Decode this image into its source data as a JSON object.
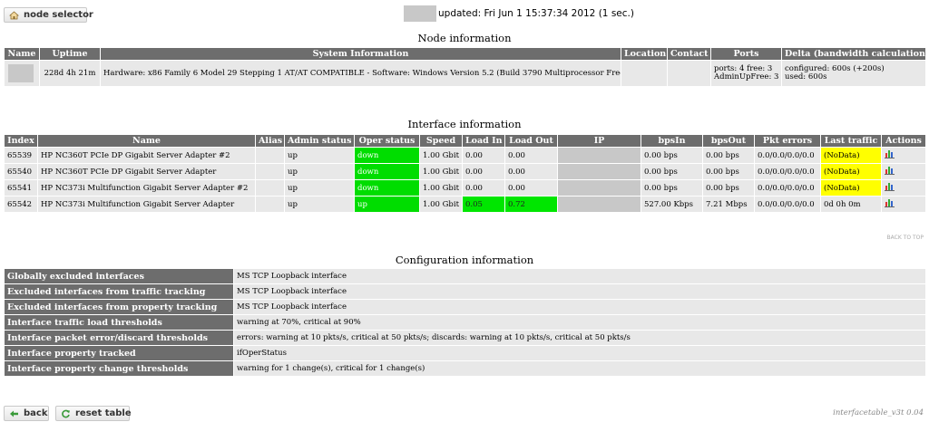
{
  "toolbar": {
    "node_selector_label": "node selector",
    "updated_text": "updated: Fri Jun 1 15:37:34 2012 (1 sec.)"
  },
  "node": {
    "title": "Node information",
    "headers": [
      "Name",
      "Uptime",
      "System Information",
      "Location",
      "Contact",
      "Ports",
      "Delta (bandwidth calculations)"
    ],
    "uptime": "228d 4h 21m",
    "system_info": "Hardware: x86 Family 6 Model 29 Stepping 1 AT/AT COMPATIBLE - Software: Windows Version 5.2 (Build 3790 Multiprocessor Free)",
    "location": "",
    "contact": "",
    "ports_line1": "ports: 4 free: 3",
    "ports_line2": "AdminUpFree: 3",
    "delta_line1": "configured: 600s (+200s)",
    "delta_line2": "used: 600s"
  },
  "interfaces": {
    "title": "Interface information",
    "headers": [
      "Index",
      "Name",
      "Alias",
      "Admin status",
      "Oper status",
      "Speed",
      "Load In",
      "Load Out",
      "IP",
      "bpsIn",
      "bpsOut",
      "Pkt errors",
      "Last traffic",
      "Actions"
    ],
    "rows": [
      {
        "index": "65539",
        "name": "HP NC360T PCIe DP Gigabit Server Adapter #2",
        "alias": "",
        "admin": "up",
        "oper": "down",
        "speed": "1.00 Gbit",
        "load_in": "0.00",
        "load_out": "0.00",
        "bps_in": "0.00 bps",
        "bps_out": "0.00 bps",
        "pkt_errors": "0.0/0.0/0.0/0.0",
        "last_traffic": "(NoData)"
      },
      {
        "index": "65540",
        "name": "HP NC360T PCIe DP Gigabit Server Adapter",
        "alias": "",
        "admin": "up",
        "oper": "down",
        "speed": "1.00 Gbit",
        "load_in": "0.00",
        "load_out": "0.00",
        "bps_in": "0.00 bps",
        "bps_out": "0.00 bps",
        "pkt_errors": "0.0/0.0/0.0/0.0",
        "last_traffic": "(NoData)"
      },
      {
        "index": "65541",
        "name": "HP NC373i Multifunction Gigabit Server Adapter #2",
        "alias": "",
        "admin": "up",
        "oper": "down",
        "speed": "1.00 Gbit",
        "load_in": "0.00",
        "load_out": "0.00",
        "bps_in": "0.00 bps",
        "bps_out": "0.00 bps",
        "pkt_errors": "0.0/0.0/0.0/0.0",
        "last_traffic": "(NoData)"
      },
      {
        "index": "65542",
        "name": "HP NC373i Multifunction Gigabit Server Adapter",
        "alias": "",
        "admin": "up",
        "oper": "up",
        "speed": "1.00 Gbit",
        "load_in": "0.05",
        "load_out": "0.72",
        "bps_in": "527.00 Kbps",
        "bps_out": "7.21 Mbps",
        "pkt_errors": "0.0/0.0/0.0/0.0",
        "last_traffic": "0d 0h 0m"
      }
    ],
    "back_to_top": "BACK TO TOP"
  },
  "config": {
    "title": "Configuration information",
    "rows": [
      {
        "label": "Globally excluded interfaces",
        "value": "MS TCP Loopback interface"
      },
      {
        "label": "Excluded interfaces from traffic tracking",
        "value": "MS TCP Loopback interface"
      },
      {
        "label": "Excluded interfaces from property tracking",
        "value": "MS TCP Loopback interface"
      },
      {
        "label": "Interface traffic load thresholds",
        "value": "warning at 70%, critical at 90%"
      },
      {
        "label": "Interface packet error/discard thresholds",
        "value": "errors: warning at 10 pkts/s, critical at 50 pkts/s; discards: warning at 10 pkts/s, critical at 50 pkts/s"
      },
      {
        "label": "Interface property tracked",
        "value": "ifOperStatus"
      },
      {
        "label": "Interface property change thresholds",
        "value": "warning for 1 change(s), critical for 1 change(s)"
      }
    ]
  },
  "footer": {
    "back_label": "back",
    "reset_label": "reset table",
    "version": "interfacetable_v3t 0.04"
  },
  "colors": {
    "header_bg": "#6d6d6d",
    "cell_bg": "#e8e8e8",
    "status_down": "#00dd00",
    "load_ok": "#00e600",
    "nodata": "#ffff00"
  },
  "icons": {
    "node_selector": "home-icon",
    "back": "back-arrow-icon",
    "reset": "refresh-icon",
    "action": "bar-chart-icon"
  }
}
